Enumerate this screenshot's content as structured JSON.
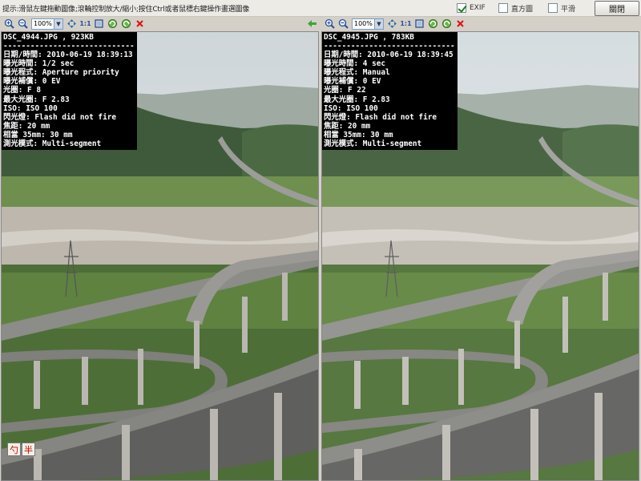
{
  "hint_text": "提示:滑鼠左鍵拖動圖像;滾輪控制放大/縮小;按住Ctrl或者鼠標右鍵操作畫選圖像",
  "options": {
    "exif_label": "EXIF",
    "exif_checked": true,
    "histogram_label": "直方圖",
    "histogram_checked": false,
    "sync_label": "平滑",
    "sync_checked": false
  },
  "close_label": "關閉",
  "toolbars": [
    {
      "zoom": "100%",
      "icons": [
        "zoom-in-icon",
        "zoom-out-icon",
        "fit-icon",
        "actual-size-icon",
        "fullscreen-icon",
        "rotate-left-icon",
        "rotate-right-icon",
        "delete-icon"
      ],
      "back_icon": "arrow-left-icon"
    },
    {
      "zoom": "100%",
      "icons": [
        "zoom-in-icon",
        "zoom-out-icon",
        "fit-icon",
        "actual-size-icon",
        "fullscreen-icon",
        "rotate-left-icon",
        "rotate-right-icon",
        "delete-icon"
      ]
    }
  ],
  "left": {
    "title": "DSC_4944.JPG , 923KB",
    "separator": "------------------------------------",
    "lines": [
      "日期/時間: 2010-06-19 18:39:13",
      "曝光時間: 1/2 sec",
      "曝光程式: Aperture priority",
      "曝光補償: 0 EV",
      "光圈: F 8",
      "最大光圈: F 2.83",
      "ISO: ISO 100",
      "閃光燈: Flash did not fire",
      "焦距: 20 mm",
      "相當 35mm: 30 mm",
      "測光模式: Multi-segment"
    ],
    "corner_buttons": [
      "勺",
      "半"
    ]
  },
  "right": {
    "title": "DSC_4945.JPG , 783KB",
    "separator": "------------------------------------",
    "lines": [
      "日期/時間: 2010-06-19 18:39:45",
      "曝光時間: 4 sec",
      "曝光程式: Manual",
      "曝光補償: 0 EV",
      "光圈: F 22",
      "最大光圈: F 2.83",
      "ISO: ISO 100",
      "閃光燈: Flash did not fire",
      "焦距: 20 mm",
      "相當 35mm: 30 mm",
      "測光模式: Multi-segment"
    ]
  }
}
